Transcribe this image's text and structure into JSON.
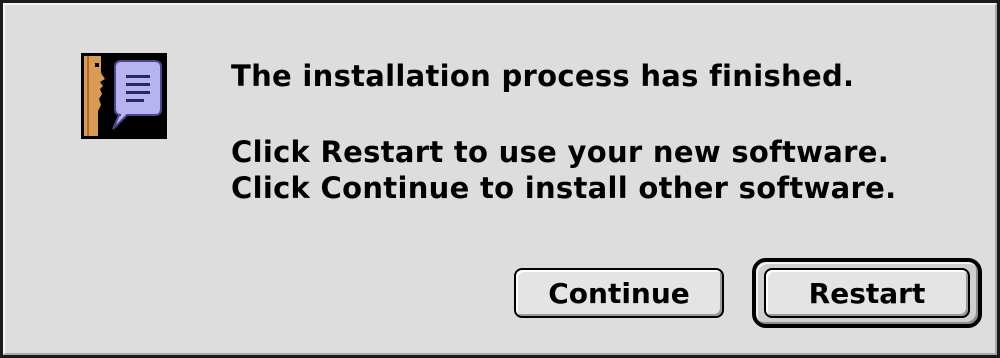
{
  "alert": {
    "icon": "installer-speech-bubble-icon",
    "title": "The installation process has finished.",
    "line1": "Click Restart to use your new software.",
    "line2": "Click Continue to install other software."
  },
  "buttons": {
    "continue_label": "Continue",
    "restart_label": "Restart",
    "default": "restart"
  },
  "colors": {
    "background": "#dddddd",
    "icon_bubble": "#b7b2f0",
    "icon_face": "#d99a56"
  }
}
